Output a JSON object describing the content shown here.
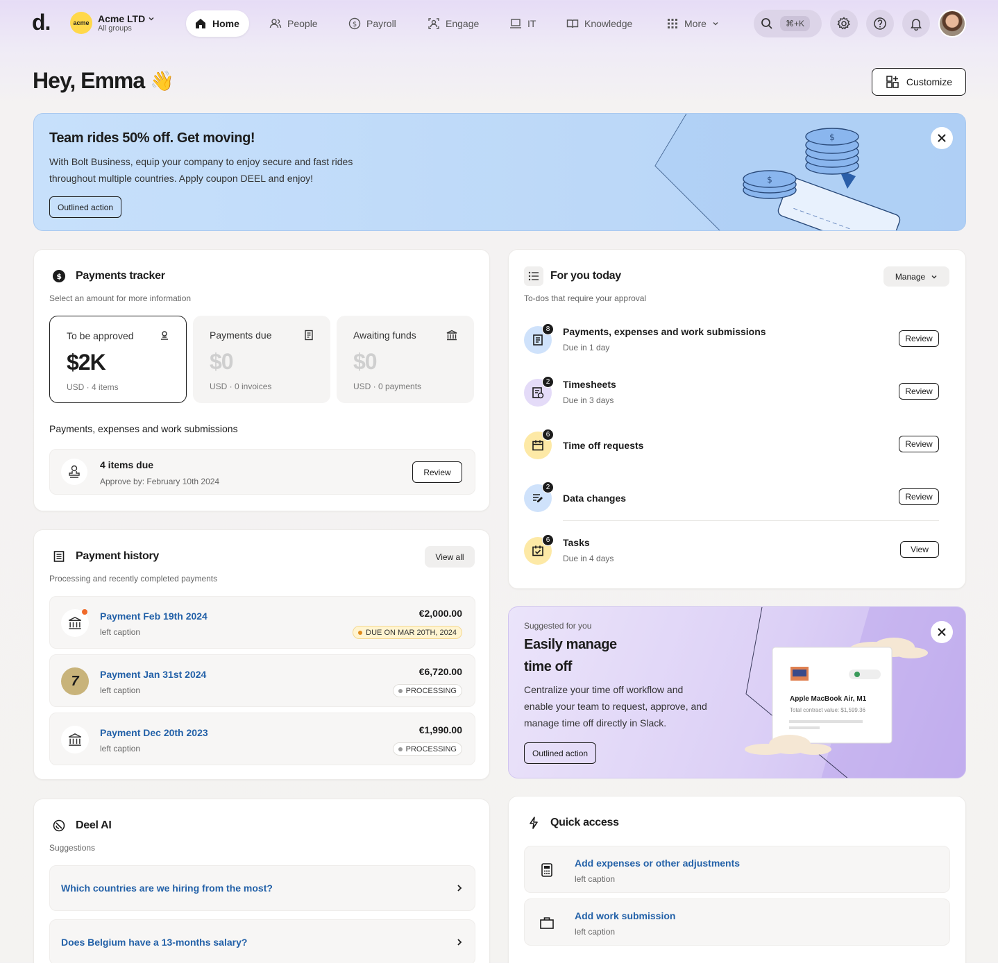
{
  "nav": {
    "logo": "d.",
    "org_badge": "acme",
    "org_name": "Acme LTD",
    "org_sub": "All groups",
    "items": [
      {
        "label": "Home",
        "icon": "home-icon"
      },
      {
        "label": "People",
        "icon": "people-icon"
      },
      {
        "label": "Payroll",
        "icon": "dollar-icon"
      },
      {
        "label": "Engage",
        "icon": "engage-icon"
      },
      {
        "label": "IT",
        "icon": "laptop-icon"
      },
      {
        "label": "Knowledge",
        "icon": "book-icon"
      },
      {
        "label": "More",
        "icon": "grid-icon"
      }
    ],
    "search_shortcut": "⌘+K"
  },
  "greeting": "Hey, Emma",
  "greeting_emoji": "👋",
  "customize_label": "Customize",
  "banner": {
    "title": "Team rides 50% off. Get moving!",
    "body": "With Bolt Business, equip your company to enjoy secure and fast rides throughout multiple countries. Apply coupon DEEL and enjoy!",
    "action": "Outlined action"
  },
  "payments_tracker": {
    "title": "Payments tracker",
    "subtitle": "Select an amount for more information",
    "stats": [
      {
        "label": "To be approved",
        "value": "$2K",
        "caption": "USD · 4 items"
      },
      {
        "label": "Payments due",
        "value": "$0",
        "caption": "USD · 0 invoices"
      },
      {
        "label": "Awaiting funds",
        "value": "$0",
        "caption": "USD · 0 payments"
      }
    ],
    "section_title": "Payments, expenses and work submissions",
    "due_title": "4 items due",
    "due_caption": "Approve by: February 10th 2024",
    "review_label": "Review"
  },
  "for_you": {
    "title": "For you today",
    "subtitle": "To-dos that require your approval",
    "manage_label": "Manage",
    "items": [
      {
        "title": "Payments, expenses and work submissions",
        "caption": "Due in 1 day",
        "count": "8",
        "action": "Review",
        "color": "#cfe2fb"
      },
      {
        "title": "Timesheets",
        "caption": "Due in 3 days",
        "count": "2",
        "action": "Review",
        "color": "#e4dbf8"
      },
      {
        "title": "Time off requests",
        "caption": "",
        "count": "6",
        "action": "Review",
        "color": "#fde9a6"
      },
      {
        "title": "Data changes",
        "caption": "",
        "count": "2",
        "action": "Review",
        "color": "#cfe2fb"
      },
      {
        "title": "Tasks",
        "caption": "Due in 4 days",
        "count": "6",
        "action": "View",
        "color": "#fde9a6"
      }
    ]
  },
  "payment_history": {
    "title": "Payment history",
    "subtitle": "Processing and recently completed payments",
    "view_all": "View all",
    "rows": [
      {
        "title": "Payment Feb 19th 2024",
        "caption": "left caption",
        "amount": "€2,000.00",
        "status": "DUE ON MAR 20TH, 2024"
      },
      {
        "title": "Payment Jan 31st 2024",
        "caption": "left caption",
        "amount": "€6,720.00",
        "status": "PROCESSING"
      },
      {
        "title": "Payment Dec 20th 2023",
        "caption": "left caption",
        "amount": "€1,990.00",
        "status": "PROCESSING"
      }
    ]
  },
  "suggested": {
    "eyebrow": "Suggested for you",
    "title_line1": "Easily manage",
    "title_line2": "time off",
    "body": "Centralize your time off workflow and enable your team to request, approve, and manage time off directly in Slack.",
    "action": "Outlined action",
    "mock_title": "Apple MacBook Air, M1",
    "mock_caption": "Total contract value: $1,599.36"
  },
  "deel_ai": {
    "title": "Deel AI",
    "subtitle": "Suggestions",
    "items": [
      "Which countries are we hiring from the most?",
      "Does Belgium have a 13-months salary?"
    ]
  },
  "quick_access": {
    "title": "Quick access",
    "items": [
      {
        "title": "Add expenses or other adjustments",
        "caption": "left caption"
      },
      {
        "title": "Add work submission",
        "caption": "left caption"
      }
    ]
  }
}
